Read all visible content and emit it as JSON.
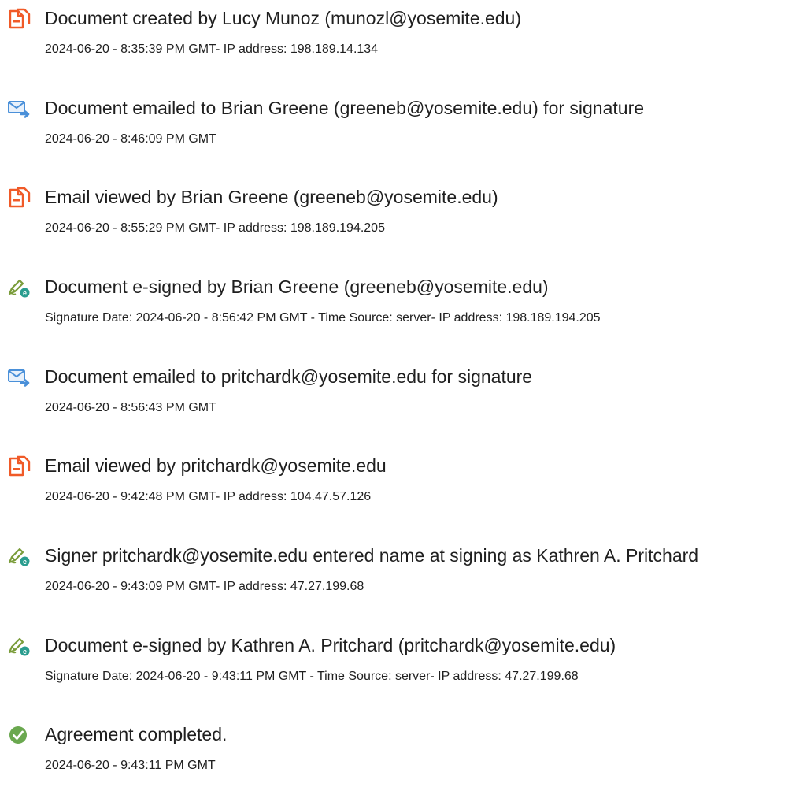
{
  "events": [
    {
      "icon": "document-icon",
      "title": "Document created by Lucy Munoz (munozl@yosemite.edu)",
      "detail": "2024-06-20 - 8:35:39 PM GMT- IP address: 198.189.14.134"
    },
    {
      "icon": "email-sent-icon",
      "title": "Document emailed to Brian Greene (greeneb@yosemite.edu) for signature",
      "detail": "2024-06-20 - 8:46:09 PM GMT"
    },
    {
      "icon": "document-icon",
      "title": "Email viewed by Brian Greene (greeneb@yosemite.edu)",
      "detail": "2024-06-20 - 8:55:29 PM GMT- IP address: 198.189.194.205"
    },
    {
      "icon": "e-sign-pen-icon",
      "title": "Document e-signed by Brian Greene (greeneb@yosemite.edu)",
      "detail": "Signature Date: 2024-06-20 - 8:56:42 PM GMT - Time Source: server- IP address: 198.189.194.205"
    },
    {
      "icon": "email-sent-icon",
      "title": "Document emailed to pritchardk@yosemite.edu for signature",
      "detail": "2024-06-20 - 8:56:43 PM GMT"
    },
    {
      "icon": "document-icon",
      "title": "Email viewed by pritchardk@yosemite.edu",
      "detail": "2024-06-20 - 9:42:48 PM GMT- IP address: 104.47.57.126"
    },
    {
      "icon": "e-sign-pen-icon",
      "title": "Signer pritchardk@yosemite.edu entered name at signing as Kathren A. Pritchard",
      "detail": "2024-06-20 - 9:43:09 PM GMT- IP address: 47.27.199.68"
    },
    {
      "icon": "e-sign-pen-icon",
      "title": "Document e-signed by Kathren A. Pritchard (pritchardk@yosemite.edu)",
      "detail": "Signature Date: 2024-06-20 - 9:43:11 PM GMT - Time Source: server- IP address: 47.27.199.68"
    },
    {
      "icon": "check-circle-icon",
      "title": "Agreement completed.",
      "detail": "2024-06-20 - 9:43:11 PM GMT"
    }
  ],
  "colors": {
    "document_icon": "#f05a28",
    "email_icon": "#4a90d9",
    "pen_icon": "#7a9c3a",
    "pen_badge": "#2a9d8f",
    "check_icon": "#6aa84f"
  }
}
